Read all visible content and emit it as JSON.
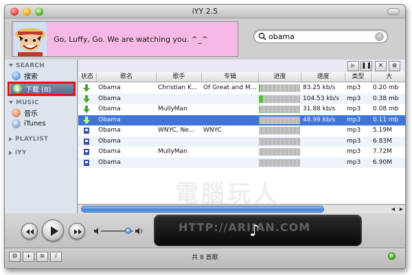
{
  "window": {
    "title": "iYY 2.5"
  },
  "banner": {
    "text": "Go, Luffy, Go. We are watching you. ^_^"
  },
  "search": {
    "value": "obama",
    "placeholder": ""
  },
  "sidebar": {
    "search_header": "SEARCH",
    "search_item": "搜索",
    "download_item": "下载 (8)",
    "music_header": "MUSIC",
    "music_item": "音乐",
    "itunes_item": "iTunes",
    "playlist_header": "PLAYLIST",
    "iyy_header": "iYY"
  },
  "toolbar": {
    "play": "▶",
    "pause": "❚❚",
    "stop": "✕",
    "cancel": "⊗"
  },
  "table": {
    "headers": [
      "状态",
      "歌名",
      "歌手",
      "专辑",
      "进度",
      "速度",
      "类型",
      "大"
    ],
    "rows": [
      {
        "status": "downloading",
        "name": "Obama",
        "artist": "Christian K...",
        "album": "Of Great and M...",
        "progress": 0.03,
        "speed": "83.25 kb/s",
        "type": "mp3",
        "size": "0.20 mb"
      },
      {
        "status": "downloading",
        "name": "Obama",
        "artist": "",
        "album": "",
        "progress": 0.1,
        "speed": "104.53 kb/s",
        "type": "mp3",
        "size": "0.38 mb"
      },
      {
        "status": "downloading",
        "name": "Obama",
        "artist": "MullyMan",
        "album": "",
        "progress": 0.02,
        "speed": "31.88 kb/s",
        "type": "mp3",
        "size": "0.08 mb"
      },
      {
        "status": "downloading",
        "name": "Obama",
        "artist": "",
        "album": "",
        "progress": 0.02,
        "speed": "48.99 kb/s",
        "type": "mp3",
        "size": "0.11 mb"
      },
      {
        "status": "queued",
        "name": "Obama",
        "artist": "WNYC, Ne...",
        "album": "WNYC",
        "progress": 0,
        "speed": "",
        "type": "mp3",
        "size": "5.19M"
      },
      {
        "status": "queued",
        "name": "Obama",
        "artist": "",
        "album": "",
        "progress": 0,
        "speed": "",
        "type": "mp3",
        "size": "6.83M"
      },
      {
        "status": "queued",
        "name": "Obama",
        "artist": "MullyMan",
        "album": "",
        "progress": 0,
        "speed": "",
        "type": "mp3",
        "size": "7.72M"
      },
      {
        "status": "queued",
        "name": "Obama",
        "artist": "",
        "album": "",
        "progress": 0,
        "speed": "",
        "type": "mp3",
        "size": "6.90M"
      }
    ]
  },
  "player": {
    "rewind": "◀◀",
    "play": "▶",
    "forward": "▶▶",
    "volume_level": 0.85,
    "now_playing_icon": "music-note-icon",
    "note_glyph": "♪"
  },
  "statusbar": {
    "text": "共 8 首歌"
  },
  "watermark": {
    "url": "HTTP://ARIIAN.COM"
  },
  "colors": {
    "selection_blue": "#3f74d8",
    "sidebar_bg": "#dde4ee",
    "banner_pink": "#f6b8e4",
    "highlight_red": "#e81010",
    "progress_green": "#55c23a"
  }
}
